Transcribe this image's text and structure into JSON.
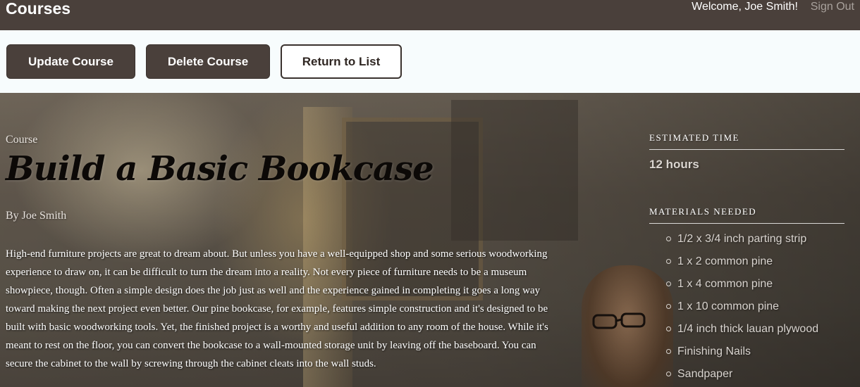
{
  "header": {
    "brand": "Courses",
    "welcome": "Welcome, Joe Smith!",
    "sign_out": "Sign Out"
  },
  "actions": {
    "update": "Update Course",
    "delete": "Delete Course",
    "return": "Return to List"
  },
  "course": {
    "label": "Course",
    "title": "Build a Basic Bookcase",
    "author": "By Joe Smith",
    "description": "High-end furniture projects are great to dream about. But unless you have a well-equipped shop and some serious woodworking experience to draw on, it can be difficult to turn the dream into a reality. Not every piece of furniture needs to be a museum showpiece, though. Often a simple design does the job just as well and the experience gained in completing it goes a long way toward making the next project even better. Our pine bookcase, for example, features simple construction and it's designed to be built with basic woodworking tools. Yet, the finished project is a worthy and useful addition to any room of the house. While it's meant to rest on the floor, you can convert the bookcase to a wall-mounted storage unit by leaving off the baseboard. You can secure the cabinet to the wall by screwing through the cabinet cleats into the wall studs."
  },
  "sidebar": {
    "estimated_time_heading": "ESTIMATED TIME",
    "estimated_time_value": "12 hours",
    "materials_heading": "MATERIALS NEEDED",
    "materials": [
      "1/2 x 3/4 inch parting strip",
      "1 x 2 common pine",
      "1 x 4 common pine",
      "1 x 10 common pine",
      "1/4 inch thick lauan plywood",
      "Finishing Nails",
      "Sandpaper"
    ]
  },
  "colors": {
    "header_bg": "#4a403b",
    "button_dark": "#4a403b",
    "page_bg": "#f7fcfd"
  },
  "icons": {
    "list_bullet": "hollow-circle"
  }
}
